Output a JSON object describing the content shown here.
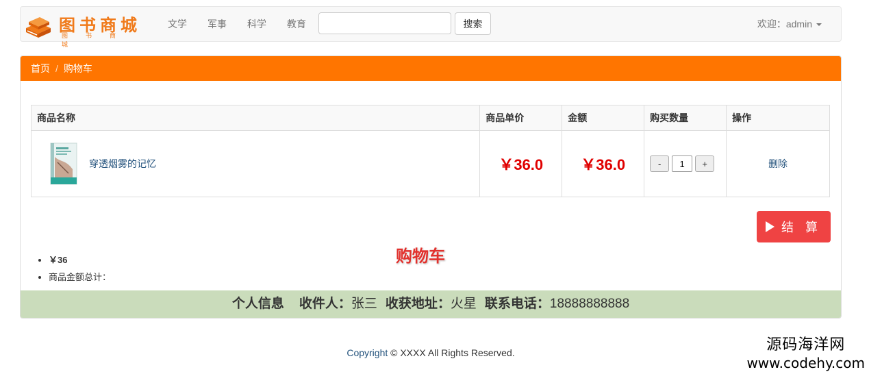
{
  "navbar": {
    "logo_text": "图书商城",
    "logo_sub": "图书商城",
    "links": [
      "文学",
      "军事",
      "科学",
      "教育"
    ],
    "search": {
      "value": "",
      "placeholder": "",
      "button_label": "搜索"
    },
    "user_label": "欢迎：admin"
  },
  "breadcrumb": {
    "home": "首页",
    "separator": "/",
    "current": "购物车"
  },
  "table": {
    "headers": [
      "商品名称",
      "商品单价",
      "金额",
      "购买数量",
      "操作"
    ],
    "rows": [
      {
        "product_name": "穿透烟雾的记忆",
        "unit_price": "￥36.0",
        "amount": "￥36.0",
        "quantity": "1",
        "minus_label": "-",
        "plus_label": "+",
        "action_label": "删除"
      }
    ]
  },
  "checkout": {
    "label": "结 算"
  },
  "heading": "购物车",
  "summary": {
    "total": "￥36",
    "total_label": "商品金额总计："
  },
  "info_bar": {
    "personal_label": "个人信息",
    "recipient_label": "收件人：",
    "recipient": "张三",
    "address_label": "收获地址：",
    "address": "火星",
    "phone_label": "联系电话：",
    "phone": "18888888888"
  },
  "footer": {
    "copyright_link": "Copyright",
    "text": "© XXXX All Rights Reserved."
  },
  "watermark": {
    "line1": "源码海洋网",
    "line2": "www.codehy.com"
  },
  "colors": {
    "brand_orange": "#ff7500",
    "price_red": "#e00000",
    "checkout_red": "#ef4343",
    "info_green": "#cadcbb"
  }
}
